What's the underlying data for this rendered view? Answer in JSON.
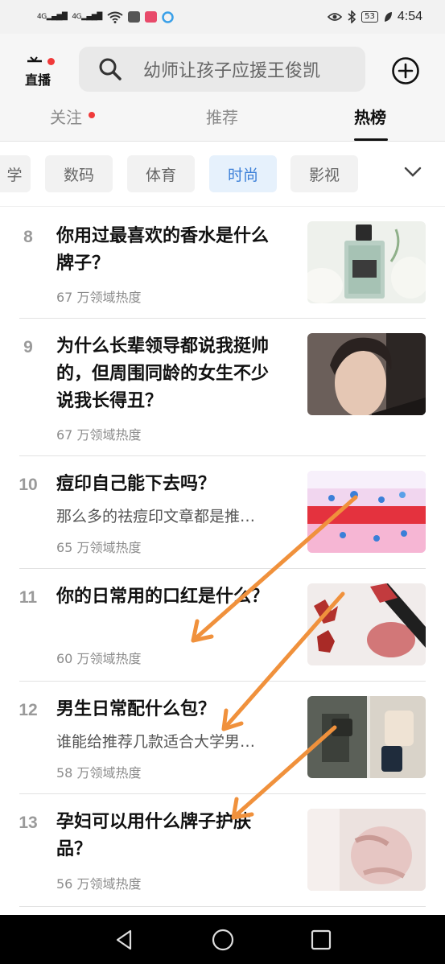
{
  "status_bar": {
    "signal_1": "4G",
    "signal_2": "4G",
    "battery": "53",
    "time": "4:54"
  },
  "header": {
    "live_label": "直播",
    "search_placeholder": "幼师让孩子应援王俊凯",
    "tabs": [
      {
        "label": "关注",
        "has_dot": true
      },
      {
        "label": "推荐"
      },
      {
        "label": "热榜",
        "active": true
      }
    ]
  },
  "categories": {
    "items": [
      "学",
      "数码",
      "体育",
      "时尚",
      "影视"
    ],
    "active": "时尚"
  },
  "hot_list": [
    {
      "rank": "8",
      "title": "你用过最喜欢的香水是什么牌子？",
      "subtitle": "",
      "heat": "67 万领域热度",
      "thumb": "perfume-bottle-image"
    },
    {
      "rank": "9",
      "title": "为什么长辈领导都说我挺帅的，但周围同龄的女生不少说我长得丑？",
      "subtitle": "",
      "heat": "67 万领域热度",
      "thumb": "young-man-portrait-image"
    },
    {
      "rank": "10",
      "title": "痘印自己能下去吗？",
      "subtitle": "那么多的祛痘印文章都是推…",
      "heat": "65 万领域热度",
      "thumb": "skin-diagram-image"
    },
    {
      "rank": "11",
      "title": "你的日常用的口红是什么？",
      "subtitle": "",
      "heat": "60 万领域热度",
      "thumb": "lipstick-swatch-image"
    },
    {
      "rank": "12",
      "title": "男生日常配什么包？",
      "subtitle": "谁能给推荐几款适合大学男…",
      "heat": "58 万领域热度",
      "thumb": "bags-outfit-image"
    },
    {
      "rank": "13",
      "title": "孕妇可以用什么牌子护肤品？",
      "subtitle": "",
      "heat": "56 万领域热度",
      "thumb": "pregnant-belly-image"
    }
  ],
  "colors": {
    "accent_blue": "#3b7fd8",
    "red_dot": "#f03a3a",
    "overlay_arrow": "#f0913c"
  }
}
